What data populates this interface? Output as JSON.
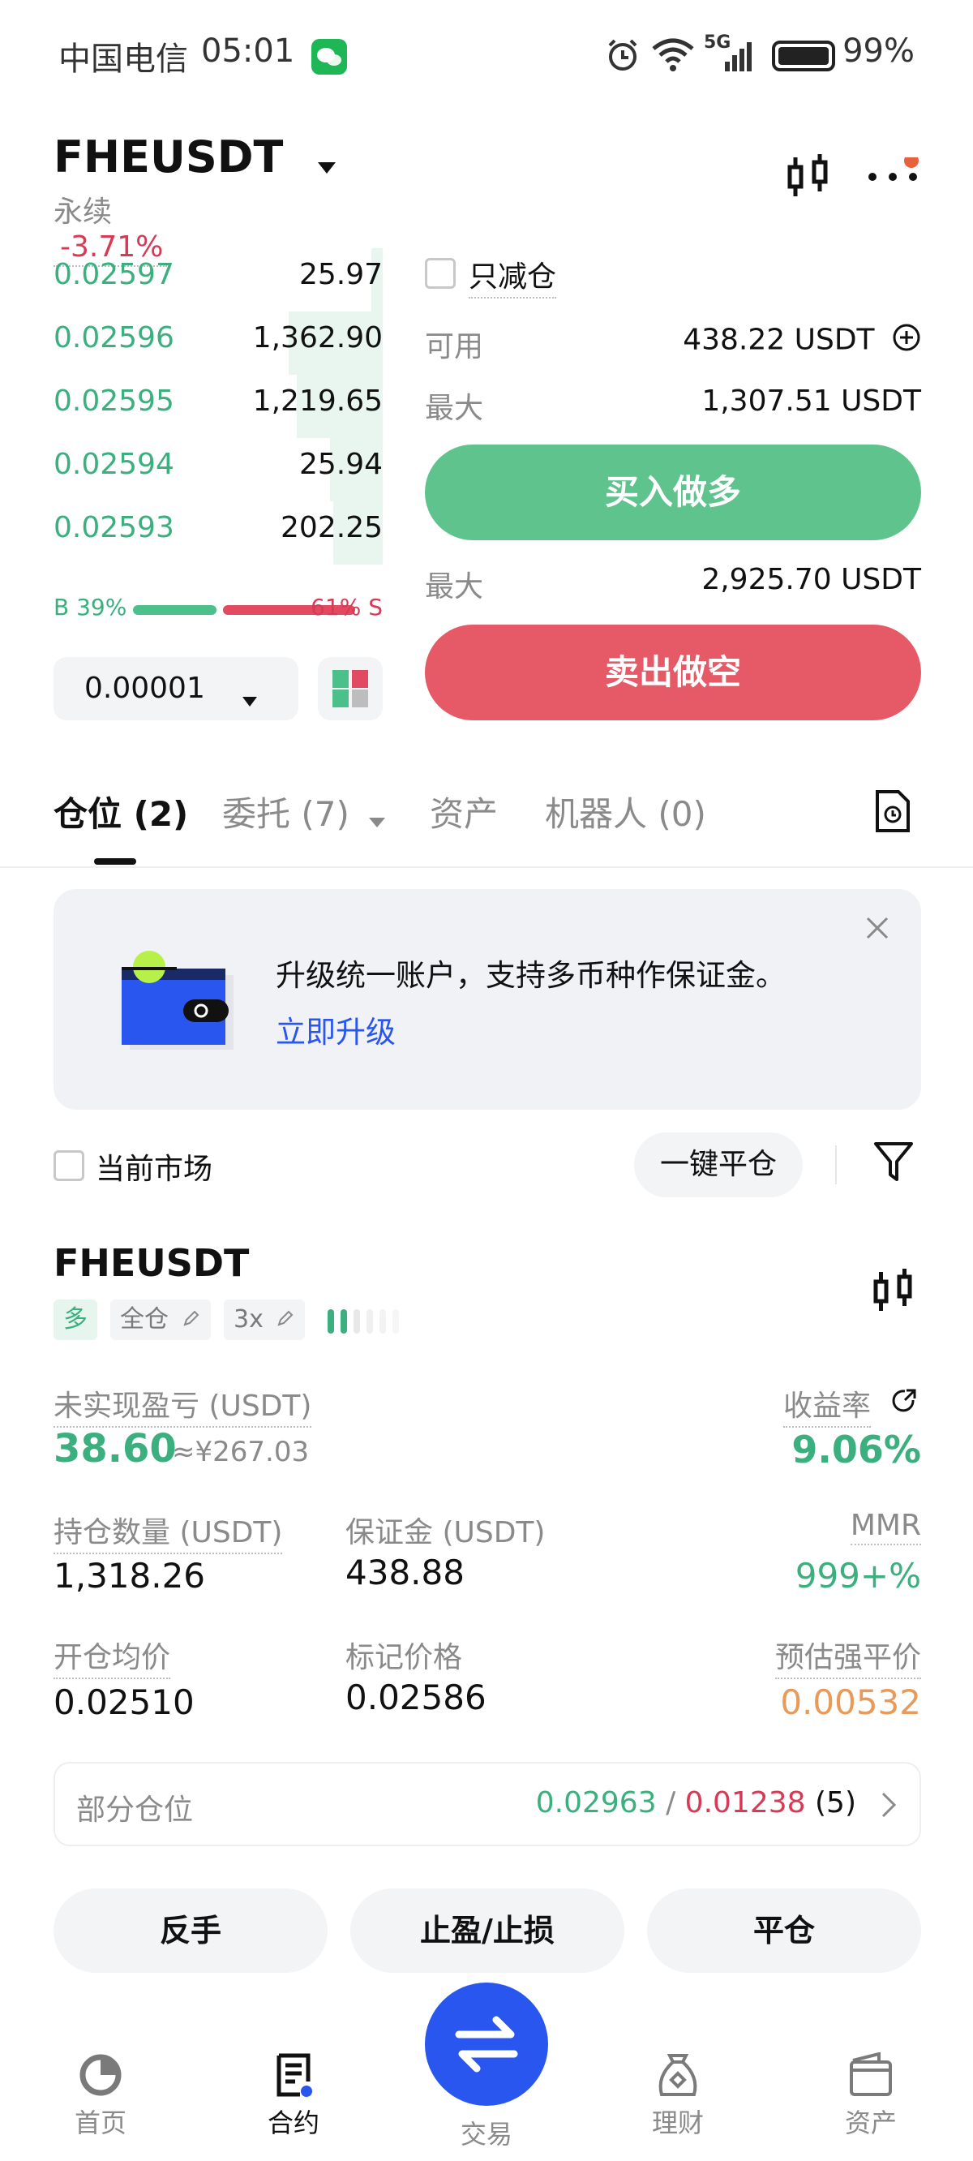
{
  "status_bar": {
    "carrier": "中国电信",
    "time": "05:01",
    "network": "5G",
    "battery": "99%"
  },
  "header": {
    "pair": "FHEUSDT",
    "type": "永续",
    "change": "-3.71%"
  },
  "orderbook": {
    "rows": [
      {
        "price": "0.02597",
        "qty": "25.97",
        "depth": 0.12
      },
      {
        "price": "0.02596",
        "qty": "1,362.90",
        "depth": 0.98
      },
      {
        "price": "0.02595",
        "qty": "1,219.65",
        "depth": 0.9
      },
      {
        "price": "0.02594",
        "qty": "25.94",
        "depth": 0.55
      },
      {
        "price": "0.02593",
        "qty": "202.25",
        "depth": 0.52
      }
    ],
    "buy_ratio_label": "B 39%",
    "sell_ratio_label": "61% S",
    "buy_ratio": 0.39,
    "precision": "0.00001"
  },
  "trade_panel": {
    "reduce_only_label": "只减仓",
    "available_label": "可用",
    "available_value": "438.22 USDT",
    "max_label": "最大",
    "max_long_value": "1,307.51 USDT",
    "buy_long_button": "买入做多",
    "max_short_value": "2,925.70 USDT",
    "sell_short_button": "卖出做空"
  },
  "tabs": [
    {
      "label": "仓位 (2)"
    },
    {
      "label": "委托 (7)"
    },
    {
      "label": "资产"
    },
    {
      "label": "机器人 (0)"
    }
  ],
  "banner": {
    "text": "升级统一账户，支持多币种作保证金。",
    "link": "立即升级"
  },
  "filter": {
    "current_market_label": "当前市场",
    "close_all_button": "一键平仓"
  },
  "position": {
    "pair": "FHEUSDT",
    "side_tag": "多",
    "margin_mode_tag": "全仓",
    "leverage_tag": "3x",
    "unrealized_label": "未实现盈亏 (USDT)",
    "unrealized_value": "38.60",
    "unrealized_cny": "≈¥267.03",
    "roi_label": "收益率",
    "roi_value": "9.06%",
    "size_label": "持仓数量 (USDT)",
    "size_value": "1,318.26",
    "margin_label": "保证金 (USDT)",
    "margin_value": "438.88",
    "mmr_label": "MMR",
    "mmr_value": "999+%",
    "entry_label": "开仓均价",
    "entry_value": "0.02510",
    "mark_label": "标记价格",
    "mark_value": "0.02586",
    "liq_label": "预估强平价",
    "liq_value": "0.00532",
    "partial_label": "部分仓位",
    "partial_tp": "0.02963",
    "partial_sep": "/",
    "partial_sl": "0.01238",
    "partial_count": "(5)",
    "reverse_button": "反手",
    "tpsl_button": "止盈/止损",
    "close_button": "平仓"
  },
  "bottom_nav": [
    {
      "label": "首页",
      "icon": "home-icon"
    },
    {
      "label": "合约",
      "icon": "futures-icon"
    },
    {
      "label": "交易",
      "icon": "swap-icon"
    },
    {
      "label": "理财",
      "icon": "earn-icon"
    },
    {
      "label": "资产",
      "icon": "wallet-icon"
    }
  ],
  "colors": {
    "green": "#3bb07e",
    "red": "#d63a55",
    "buy_button": "#5fc38e",
    "sell_button": "#e65a68",
    "accent_blue": "#2a56f0",
    "liq_orange": "#e89a5a"
  }
}
